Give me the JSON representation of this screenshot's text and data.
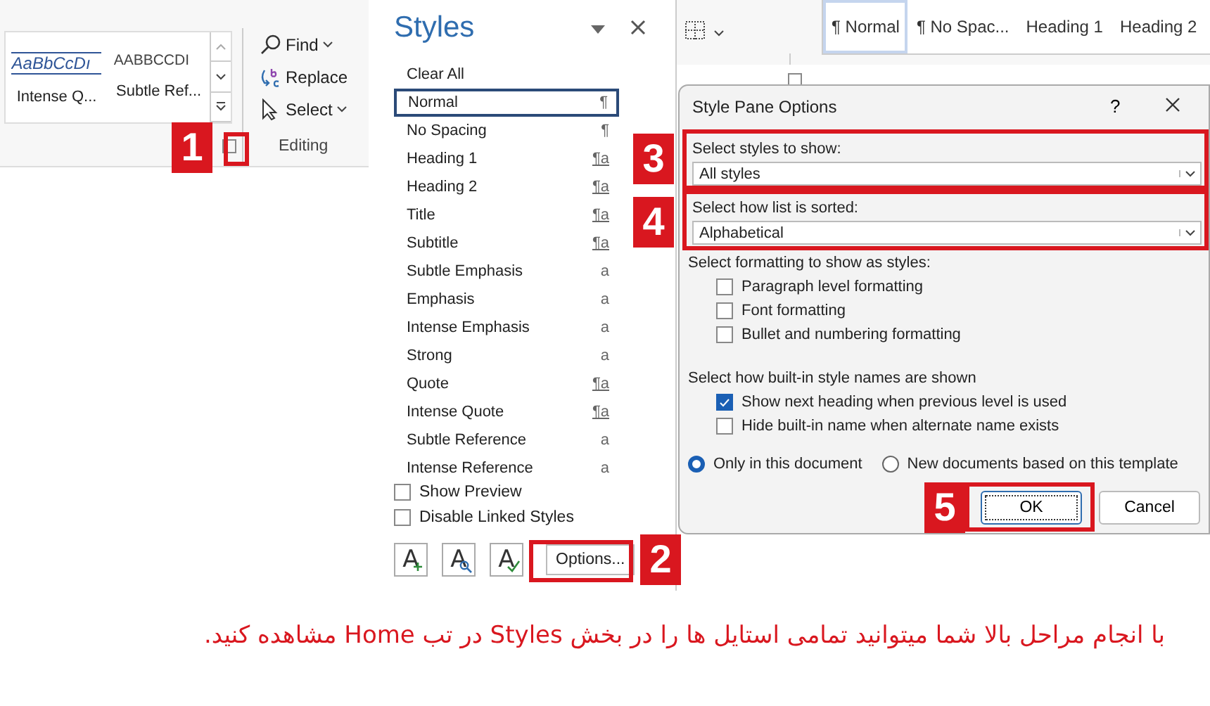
{
  "ribbon": {
    "gallery": [
      {
        "sample": "AaBbCcDı",
        "label": "Intense Q...",
        "kind": "intense"
      },
      {
        "sample": "AABBCCDI",
        "label": "Subtle Ref...",
        "kind": "caps"
      }
    ],
    "editing": {
      "items": [
        {
          "label": "Find",
          "kind": "find",
          "dropdown": true
        },
        {
          "label": "Replace",
          "kind": "replace",
          "dropdown": false
        },
        {
          "label": "Select",
          "kind": "select",
          "dropdown": true
        }
      ],
      "group_label": "Editing"
    }
  },
  "quick_styles": [
    {
      "label": "¶ Normal",
      "selected": true
    },
    {
      "label": "¶ No Spac...",
      "selected": false
    },
    {
      "label": "Heading 1",
      "selected": false
    },
    {
      "label": "Heading 2",
      "selected": false
    }
  ],
  "styles_pane": {
    "title": "Styles",
    "clear_all": "Clear All",
    "items": [
      {
        "name": "Normal",
        "mark": "¶",
        "kind": "paragraph",
        "selected": true
      },
      {
        "name": "No Spacing",
        "mark": "¶",
        "kind": "paragraph",
        "selected": false
      },
      {
        "name": "Heading 1",
        "mark": "¶a",
        "kind": "linked",
        "selected": false
      },
      {
        "name": "Heading 2",
        "mark": "¶a",
        "kind": "linked",
        "selected": false
      },
      {
        "name": "Title",
        "mark": "¶a",
        "kind": "linked",
        "selected": false
      },
      {
        "name": "Subtitle",
        "mark": "¶a",
        "kind": "linked",
        "selected": false
      },
      {
        "name": "Subtle Emphasis",
        "mark": "a",
        "kind": "character",
        "selected": false
      },
      {
        "name": "Emphasis",
        "mark": "a",
        "kind": "character",
        "selected": false
      },
      {
        "name": "Intense Emphasis",
        "mark": "a",
        "kind": "character",
        "selected": false
      },
      {
        "name": "Strong",
        "mark": "a",
        "kind": "character",
        "selected": false
      },
      {
        "name": "Quote",
        "mark": "¶a",
        "kind": "linked",
        "selected": false
      },
      {
        "name": "Intense Quote",
        "mark": "¶a",
        "kind": "linked",
        "selected": false
      },
      {
        "name": "Subtle Reference",
        "mark": "a",
        "kind": "character",
        "selected": false
      },
      {
        "name": "Intense Reference",
        "mark": "a",
        "kind": "character",
        "selected": false
      }
    ],
    "options": [
      {
        "label": "Show Preview",
        "checked": false
      },
      {
        "label": "Disable Linked Styles",
        "checked": false
      }
    ],
    "tools": [
      {
        "glyph": "A",
        "kind": "new"
      },
      {
        "glyph": "A",
        "kind": "inspect"
      },
      {
        "glyph": "A",
        "kind": "manage"
      }
    ],
    "options_button": "Options..."
  },
  "dialog": {
    "title": "Style Pane Options",
    "help": "?",
    "show_label": "Select styles to show:",
    "show_value": "All styles",
    "sort_label": "Select how list is sorted:",
    "sort_value": "Alphabetical",
    "formatting_label": "Select formatting to show as styles:",
    "formatting": [
      {
        "label": "Paragraph level formatting",
        "checked": false
      },
      {
        "label": "Font formatting",
        "checked": false
      },
      {
        "label": "Bullet and numbering formatting",
        "checked": false
      }
    ],
    "names_label": "Select how built-in style names are shown",
    "names": [
      {
        "label": "Show next heading when previous level is used",
        "checked": true
      },
      {
        "label": "Hide built-in name when alternate name exists",
        "checked": false
      }
    ],
    "scope": [
      {
        "label": "Only in this document",
        "selected": true
      },
      {
        "label": "New documents based on this template",
        "selected": false
      }
    ],
    "ok": "OK",
    "cancel": "Cancel"
  },
  "badges": [
    "1",
    "3",
    "4",
    "5",
    "2"
  ],
  "caption": "با انجام مراحل بالا شما میتوانید تمامی استایل ها را در بخش Styles  در تب Home مشاهده کنید."
}
